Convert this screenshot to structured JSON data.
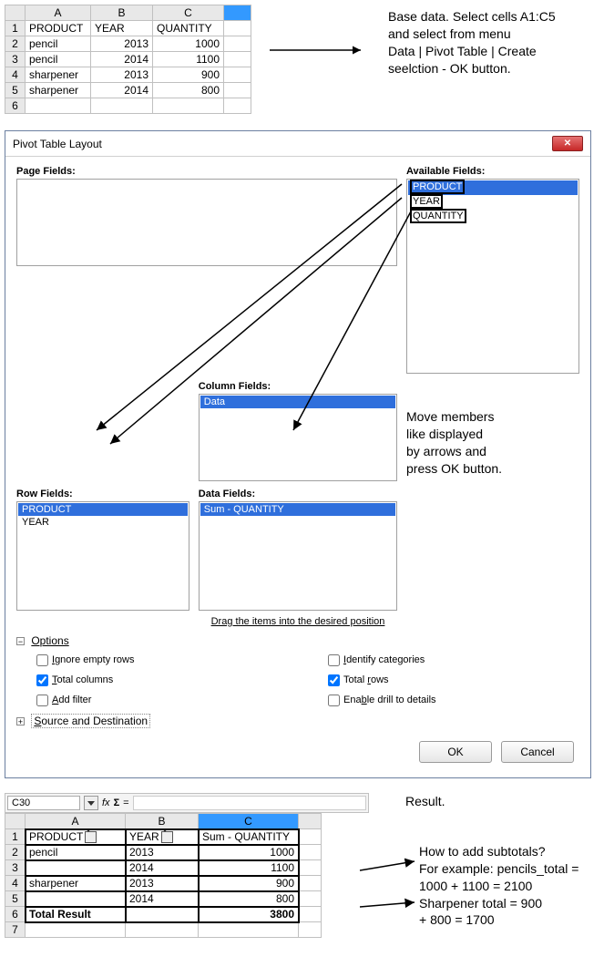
{
  "top_sheet": {
    "col_headers": [
      "A",
      "B",
      "C"
    ],
    "row_headers": [
      "1",
      "2",
      "3",
      "4",
      "5",
      "6"
    ],
    "data_headers": [
      "PRODUCT",
      "YEAR",
      "QUANTITY"
    ],
    "rows": [
      {
        "product": "pencil",
        "year": "2013",
        "qty": "1000"
      },
      {
        "product": "pencil",
        "year": "2014",
        "qty": "1100"
      },
      {
        "product": "sharpener",
        "year": "2013",
        "qty": "900"
      },
      {
        "product": "sharpener",
        "year": "2014",
        "qty": "800"
      }
    ]
  },
  "annot1_l1": "Base data. Select cells A1:C5",
  "annot1_l2": "and select from menu",
  "annot1_l3": "Data | Pivot Table | Create",
  "annot1_l4": "seelction -  OK button.",
  "dialog": {
    "title": "Pivot Table Layout",
    "page_fields_label": "Page Fields:",
    "available_fields_label": "Available Fields:",
    "available_items": [
      "PRODUCT",
      "YEAR",
      "QUANTITY"
    ],
    "column_fields_label": "Column Fields:",
    "column_item": "Data",
    "row_fields_label": "Row Fields:",
    "row_items": [
      "PRODUCT",
      "YEAR"
    ],
    "data_fields_label": "Data Fields:",
    "data_item": "Sum - QUANTITY",
    "drag_msg": "Drag the items into the desired position",
    "options_label": "Options",
    "opt_ignore": "Ignore empty rows",
    "opt_totalcol": "Total columns",
    "opt_addfilter": "Add filter",
    "opt_identify": "Identify categories",
    "opt_totalrows": "Total rows",
    "opt_drill": "Enable drill to details",
    "src_dest": "Source and Destination",
    "ok": "OK",
    "cancel": "Cancel"
  },
  "annot2_l1": "Move members",
  "annot2_l2": "like displayed",
  "annot2_l3": "by arrows and",
  "annot2_l4": "press OK button.",
  "result_label": "Result.",
  "cellref": "C30",
  "fx": "fx",
  "sigma": "Σ",
  "eq": "=",
  "result_sheet": {
    "col_headers": [
      "A",
      "B",
      "C"
    ],
    "row_headers": [
      "1",
      "2",
      "3",
      "4",
      "5",
      "6",
      "7"
    ],
    "h_product": "PRODUCT",
    "h_year": "YEAR",
    "h_sum": "Sum - QUANTITY",
    "rows": [
      {
        "a": "pencil",
        "b": "2013",
        "c": "1000"
      },
      {
        "a": "",
        "b": "2014",
        "c": "1100"
      },
      {
        "a": "sharpener",
        "b": "2013",
        "c": "900"
      },
      {
        "a": "",
        "b": "2014",
        "c": "800"
      }
    ],
    "total_label": "Total Result",
    "total_val": "3800"
  },
  "annot3_l1": "How to add subtotals?",
  "annot3_l2": "For example: pencils_total =",
  "annot3_l3": "1000 + 1100 = 2100",
  "annot3_l4": "Sharpener total = 900",
  "annot3_l5": " + 800 = 1700"
}
